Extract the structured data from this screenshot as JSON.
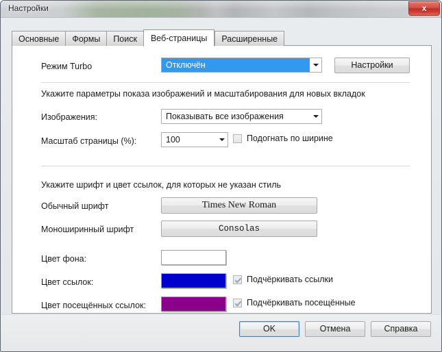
{
  "window": {
    "title": "Настройки",
    "close_label": "x"
  },
  "tabs": [
    {
      "label": "Основные",
      "active": false
    },
    {
      "label": "Формы",
      "active": false
    },
    {
      "label": "Поиск",
      "active": false
    },
    {
      "label": "Веб-страницы",
      "active": true
    },
    {
      "label": "Расширенные",
      "active": false
    }
  ],
  "turbo": {
    "label": "Режим Turbo",
    "value": "Отключён",
    "settings_button": "Настройки"
  },
  "images_section": {
    "heading": "Укажите параметры показа изображений и масштабирования для новых вкладок",
    "images_label": "Изображения:",
    "images_value": "Показывать все изображения",
    "zoom_label": "Масштаб страницы (%):",
    "zoom_value": "100",
    "fit_width_label": "Подогнать по ширине",
    "fit_width_checked": false
  },
  "fonts_section": {
    "heading": "Укажите шрифт и цвет ссылок, для которых не указан стиль",
    "normal_font_label": "Обычный шрифт",
    "normal_font_value": "Times New Roman",
    "mono_font_label": "Моноширинный шрифт",
    "mono_font_value": "Consolas",
    "bg_color_label": "Цвет фона:",
    "bg_color_value": "#FFFFFF",
    "link_color_label": "Цвет ссылок:",
    "link_color_value": "#0000CC",
    "visited_color_label": "Цвет посещённых ссылок:",
    "visited_color_value": "#8B008B",
    "underline_links_label": "Подчёркивать ссылки",
    "underline_links_checked": true,
    "underline_visited_label": "Подчёркивать посещённые",
    "underline_visited_checked": true
  },
  "footer": {
    "ok": "OK",
    "cancel": "Отмена",
    "help": "Справка"
  },
  "theme": {
    "selection_blue": "#3399EF",
    "accent_focus": "#2C86C8"
  }
}
